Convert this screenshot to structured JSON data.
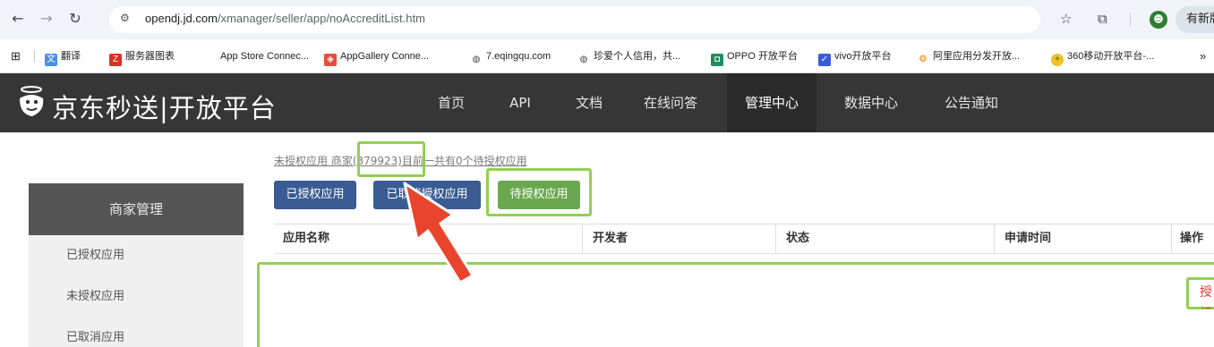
{
  "browser": {
    "url_domain": "opendj.jd.com",
    "url_path": "/xmanager/seller/app/noAccreditList.htm",
    "new_button_label": "有新版",
    "bookmarks": [
      {
        "label": "翻译",
        "icon": "translate-icon"
      },
      {
        "label": "服务器图表",
        "icon": "z-logo-icon"
      },
      {
        "label": "App Store Connec...",
        "icon": "apple-icon"
      },
      {
        "label": "AppGallery Conne...",
        "icon": "appgallery-icon"
      },
      {
        "label": "7.eqingqu.com",
        "icon": "globe-icon"
      },
      {
        "label": "珍爱个人信用，共...",
        "icon": "globe-icon"
      },
      {
        "label": "OPPO 开放平台",
        "icon": "oppo-icon"
      },
      {
        "label": "vivo开放平台",
        "icon": "vivo-icon"
      },
      {
        "label": "阿里应用分发开放...",
        "icon": "ali-icon"
      },
      {
        "label": "360移动开放平台-...",
        "icon": "360-icon"
      }
    ]
  },
  "header": {
    "logo_text": "京东秒送|开放平台",
    "nav": [
      "首页",
      "API",
      "文档",
      "在线问答",
      "管理中心",
      "数据中心",
      "公告通知"
    ],
    "active_nav": "管理中心"
  },
  "sidebar": {
    "title": "商家管理",
    "items": [
      "已授权应用",
      "未授权应用",
      "已取消应用"
    ]
  },
  "main": {
    "breadcrumb": "未授权应用 商家(379923)目前一共有0个待授权应用",
    "tabs": [
      "已授权应用",
      "已取消授权应用",
      "待授权应用"
    ],
    "columns": [
      "应用名称",
      "开发者",
      "状态",
      "申请时间",
      "操作"
    ],
    "row_action": "授权"
  },
  "colors": {
    "header_bg": "#363636",
    "tab_blue": "#3a5b93",
    "tab_green": "#6aa84f",
    "highlight": "#92d050",
    "arrow": "#e8452c"
  }
}
